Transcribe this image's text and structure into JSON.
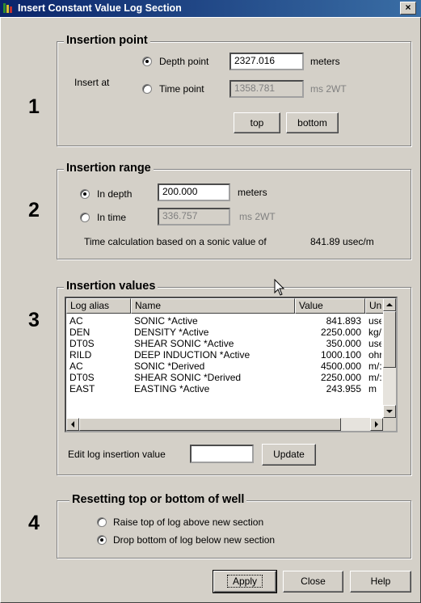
{
  "window": {
    "title": "Insert Constant Value Log Section",
    "close_glyph": "×",
    "icon": "app-log-icon"
  },
  "section1": {
    "step": "1",
    "title": "Insertion point",
    "insert_at_label": "Insert  at",
    "depth_label": "Depth point",
    "depth_value": "2327.016",
    "depth_unit": "meters",
    "time_label": "Time point",
    "time_value": "1358.781",
    "time_unit": "ms 2WT",
    "selected": "depth",
    "top_button": "top",
    "bottom_button": "bottom"
  },
  "section2": {
    "step": "2",
    "title": "Insertion range",
    "depth_label": "In depth",
    "depth_value": "200.000",
    "depth_unit": "meters",
    "time_label": "In time",
    "time_value": "336.757",
    "time_unit": "ms 2WT",
    "selected": "depth",
    "calc_text": "Time calculation based on a sonic value of",
    "calc_value": "841.89 usec/m"
  },
  "section3": {
    "step": "3",
    "title": "Insertion values",
    "columns": [
      "Log alias",
      "Name",
      "Value",
      "Un"
    ],
    "rows": [
      {
        "alias": "AC",
        "name": "SONIC *Active",
        "value": "841.893",
        "unit": "use"
      },
      {
        "alias": "DEN",
        "name": "DENSITY *Active",
        "value": "2250.000",
        "unit": "kg/"
      },
      {
        "alias": "DT0S",
        "name": "SHEAR SONIC *Active",
        "value": "350.000",
        "unit": "use"
      },
      {
        "alias": "RILD",
        "name": "DEEP INDUCTION *Active",
        "value": "1000.100",
        "unit": "ohr"
      },
      {
        "alias": "AC",
        "name": "SONIC *Derived",
        "value": "4500.000",
        "unit": "m/:"
      },
      {
        "alias": "DT0S",
        "name": "SHEAR SONIC *Derived",
        "value": "2250.000",
        "unit": "m/:"
      },
      {
        "alias": "EAST",
        "name": "EASTING *Active",
        "value": "243.955",
        "unit": "m"
      }
    ],
    "edit_label": "Edit log insertion value",
    "edit_value": "",
    "update_button": "Update"
  },
  "section4": {
    "step": "4",
    "title": "Resetting top or bottom of well",
    "raise_label": "Raise top of log above new section",
    "drop_label": "Drop bottom of log below new section",
    "selected": "drop"
  },
  "footer": {
    "apply_button": "Apply",
    "close_button": "Close",
    "help_button": "Help"
  },
  "colors": {
    "face": "#d4d0c8",
    "title_start": "#0a246a",
    "title_end": "#3a6ea5",
    "disabled_text": "#808080"
  }
}
